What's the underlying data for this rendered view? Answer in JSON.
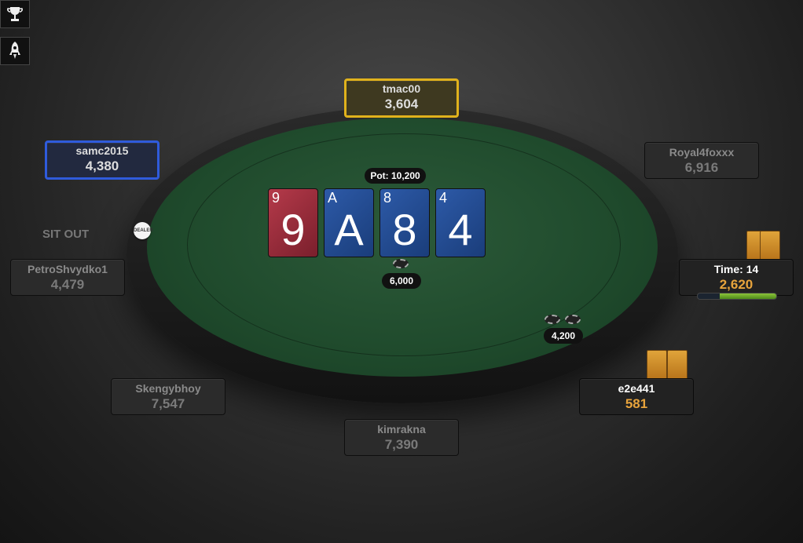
{
  "toolbar": {
    "trophy_icon": "trophy-icon",
    "rocket_icon": "rocket-icon"
  },
  "dealer_button_label": "DEALER",
  "sit_out_label": "SIT OUT",
  "pot": {
    "label": "Pot: 10,200"
  },
  "board": [
    {
      "rank": "9",
      "color": "red"
    },
    {
      "rank": "A",
      "color": "blue"
    },
    {
      "rank": "8",
      "color": "blue"
    },
    {
      "rank": "4",
      "color": "blue"
    }
  ],
  "bets": {
    "center": "6,000",
    "right": "4,200"
  },
  "seats": {
    "tmac00": {
      "name": "tmac00",
      "stack": "3,604"
    },
    "samc2015": {
      "name": "samc2015",
      "stack": "4,380"
    },
    "royal4foxxx": {
      "name": "Royal4foxxx",
      "stack": "6,916"
    },
    "petroshvydko1": {
      "name": "PetroShvydko1",
      "stack": "4,479"
    },
    "hero_timer": {
      "name": "Time: 14",
      "stack": "2,620",
      "time_remaining_fraction": 0.72
    },
    "skengybhoy": {
      "name": "Skengybhoy",
      "stack": "7,547"
    },
    "e2e441": {
      "name": "e2e441",
      "stack": "581"
    },
    "kimrakna": {
      "name": "kimrakna",
      "stack": "7,390"
    }
  },
  "colors": {
    "active_gold": "#e0b21c",
    "active_blue": "#2f5bdc",
    "stack_orange": "#e8a43c",
    "felt": "#1f4a2c"
  }
}
